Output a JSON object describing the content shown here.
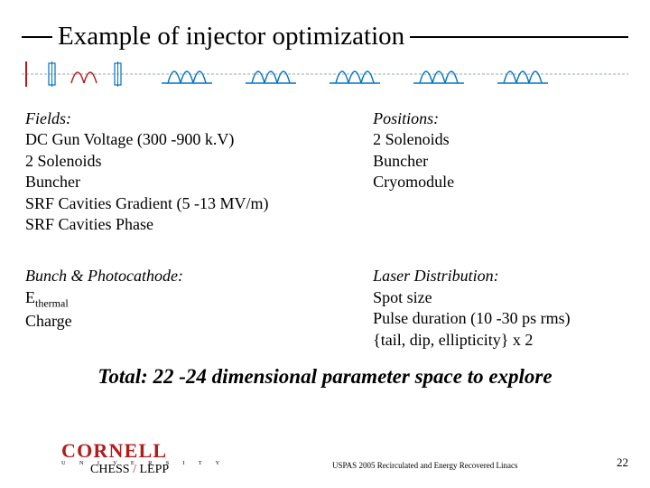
{
  "title": "Example of injector optimization",
  "blocks": {
    "fields": {
      "heading": "Fields:",
      "items": [
        "DC Gun Voltage (300 -900 k.V)",
        "2 Solenoids",
        "Buncher",
        "SRF Cavities Gradient (5 -13 MV/m)",
        "SRF Cavities Phase"
      ]
    },
    "positions": {
      "heading": "Positions:",
      "items": [
        "2 Solenoids",
        "Buncher",
        "Cryomodule"
      ]
    },
    "bunch": {
      "heading": "Bunch & Photocathode:",
      "e_label": "E",
      "e_sub": "thermal",
      "charge": "Charge"
    },
    "laser": {
      "heading": "Laser Distribution:",
      "items": [
        "Spot size",
        "Pulse duration (10 -30 ps rms)",
        "{tail, dip, ellipticity} x 2"
      ]
    }
  },
  "summary": "Total: 22 -24 dimensional parameter space to explore",
  "footer": {
    "cornell": "CORNELL",
    "university": "U N I V E R S I T Y",
    "chess": "CHESS",
    "sep": " / ",
    "lepp": "LEPP",
    "center": "USPAS 2005 Recirculated and Energy Recovered Linacs",
    "page": "22"
  }
}
